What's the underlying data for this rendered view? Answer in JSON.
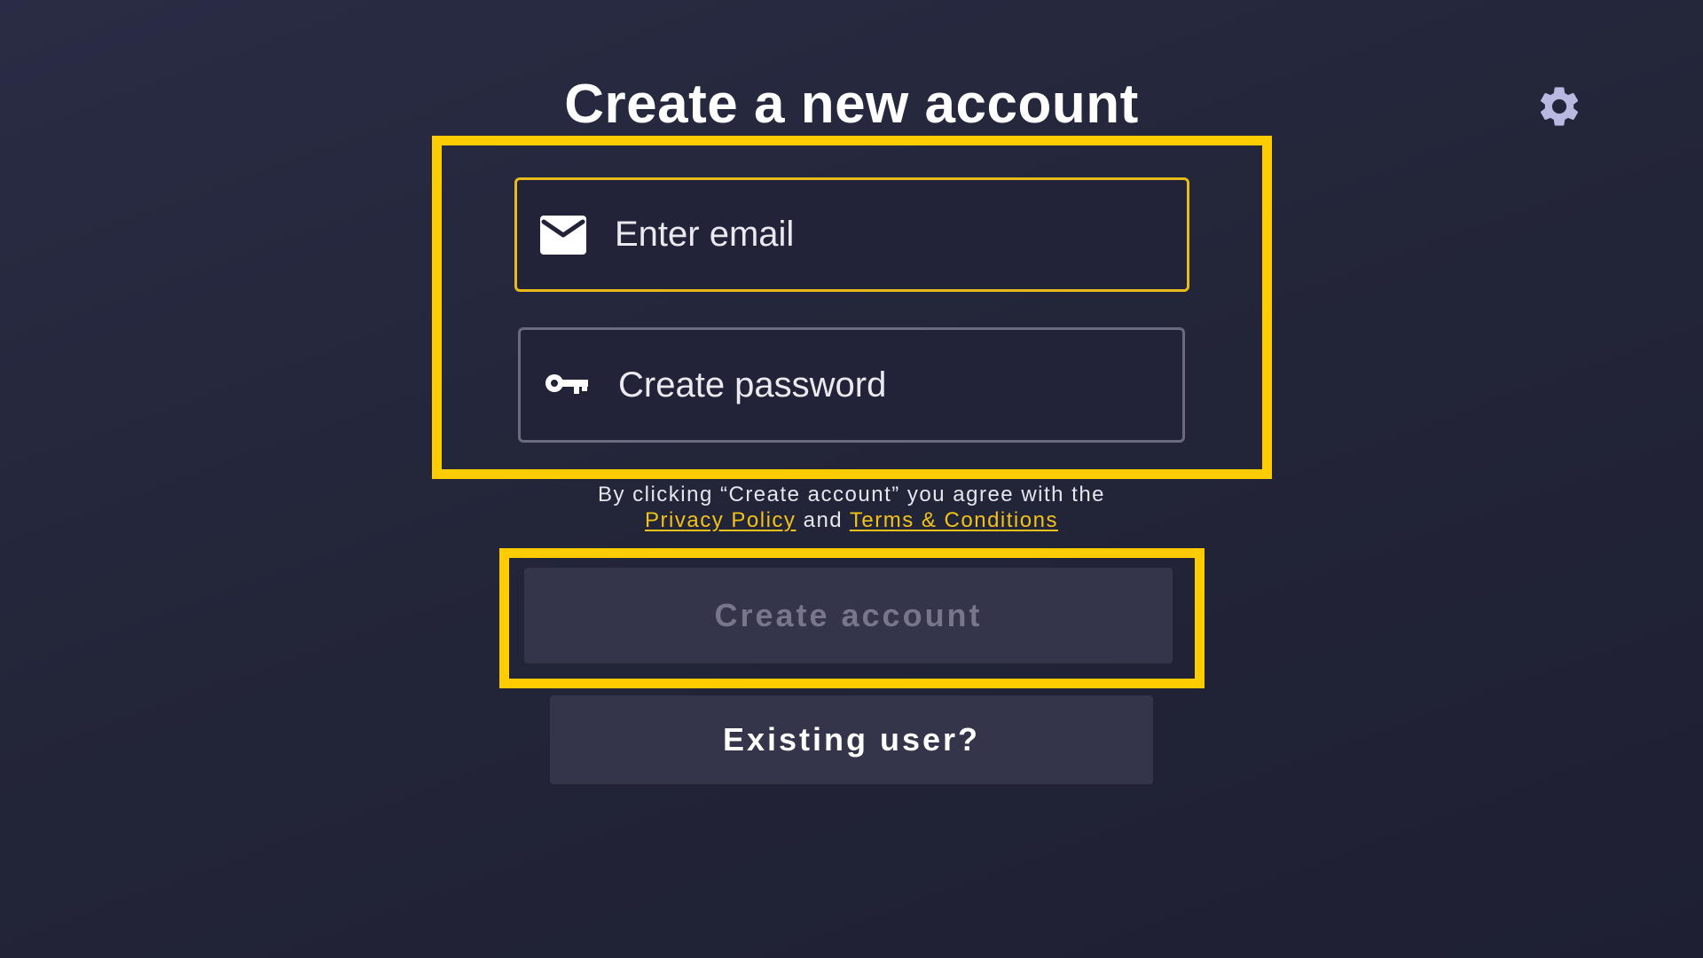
{
  "header": {
    "title": "Create a new account",
    "settings_icon": "gear-icon"
  },
  "form": {
    "email": {
      "icon": "envelope-icon",
      "placeholder": "Enter email",
      "value": ""
    },
    "password": {
      "icon": "key-icon",
      "placeholder": "Create password",
      "value": ""
    }
  },
  "consent": {
    "prefix": "By clicking “Create account” you agree with the",
    "privacy_link": "Privacy Policy",
    "joiner": "and",
    "terms_link": "Terms & Conditions"
  },
  "actions": {
    "create_label": "Create account",
    "existing_label": "Existing user?"
  },
  "colors": {
    "background": "#24263b",
    "highlight": "#ffcc00",
    "link": "#f2c21a",
    "button": "#34344a",
    "disabled_text": "#77768a"
  }
}
